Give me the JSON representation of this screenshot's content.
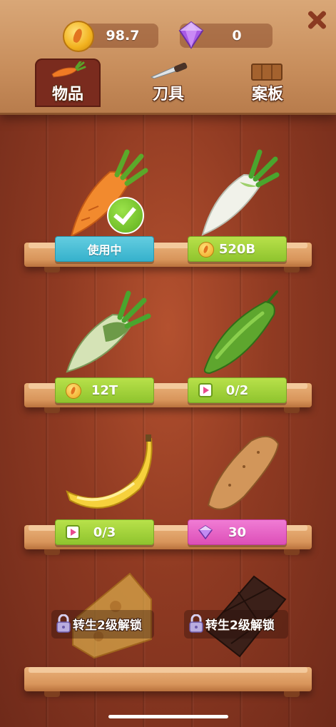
{
  "currency": {
    "coins": "98.7",
    "gems": "0",
    "coin_icon": "carrot-coin",
    "gem_icon": "purple-gem"
  },
  "tabs": [
    {
      "label": "物品",
      "icon": "carrot",
      "active": true
    },
    {
      "label": "刀具",
      "icon": "knife",
      "active": false
    },
    {
      "label": "案板",
      "icon": "cutting-board",
      "active": false
    }
  ],
  "items": [
    {
      "name": "carrot",
      "button": "使用中",
      "style": "blue",
      "selected": true
    },
    {
      "name": "white-radish",
      "button": "520B",
      "style": "green",
      "icon": "coin"
    },
    {
      "name": "green-radish",
      "button": "12T",
      "style": "green",
      "icon": "coin"
    },
    {
      "name": "cucumber",
      "button": "0/2",
      "style": "green",
      "icon": "video-ad"
    },
    {
      "name": "banana",
      "button": "0/3",
      "style": "green",
      "icon": "video-ad"
    },
    {
      "name": "sweet-potato",
      "button": "30",
      "style": "pink",
      "icon": "gem"
    },
    {
      "name": "cheese",
      "lock": "转生2级解锁"
    },
    {
      "name": "chocolate",
      "lock": "转生2级解锁"
    }
  ],
  "colors": {
    "background": "#8f3a22",
    "header": "#d9a777",
    "green_button": "#8fc42e",
    "blue_button": "#36b1cc",
    "pink_button": "#dd4fb8"
  }
}
